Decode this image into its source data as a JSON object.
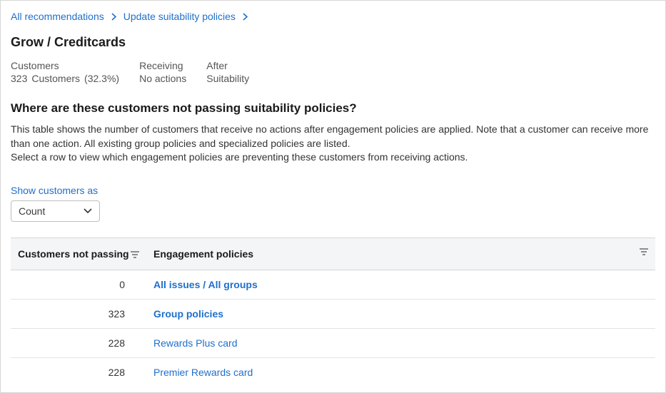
{
  "breadcrumb": {
    "items": [
      {
        "label": "All recommendations"
      },
      {
        "label": "Update suitability policies"
      }
    ]
  },
  "page_title": "Grow / Creditcards",
  "stats": {
    "customers": {
      "label": "Customers",
      "count": "323",
      "unit": "Customers",
      "pct": "(32.3%)"
    },
    "receiving": {
      "label": "Receiving",
      "value": "No actions"
    },
    "after": {
      "label": "After",
      "value": "Suitability"
    }
  },
  "section": {
    "heading": "Where are these customers not passing suitability policies?",
    "desc_line1": "This table shows the number of customers that receive no actions after engagement policies are applied. Note that a customer can receive more than one action. All existing group policies and specialized policies are listed.",
    "desc_line2": "Select a row to view which engagement policies are preventing these customers from receiving actions."
  },
  "show_customers": {
    "label": "Show customers as",
    "selected": "Count"
  },
  "table": {
    "headers": {
      "count": "Customers not passing",
      "policy": "Engagement policies"
    },
    "rows": [
      {
        "count": "0",
        "policy": "All issues / All groups",
        "bold": true
      },
      {
        "count": "323",
        "policy": "Group policies",
        "bold": true
      },
      {
        "count": "228",
        "policy": "Rewards Plus card",
        "bold": false
      },
      {
        "count": "228",
        "policy": "Premier Rewards card",
        "bold": false
      }
    ]
  }
}
